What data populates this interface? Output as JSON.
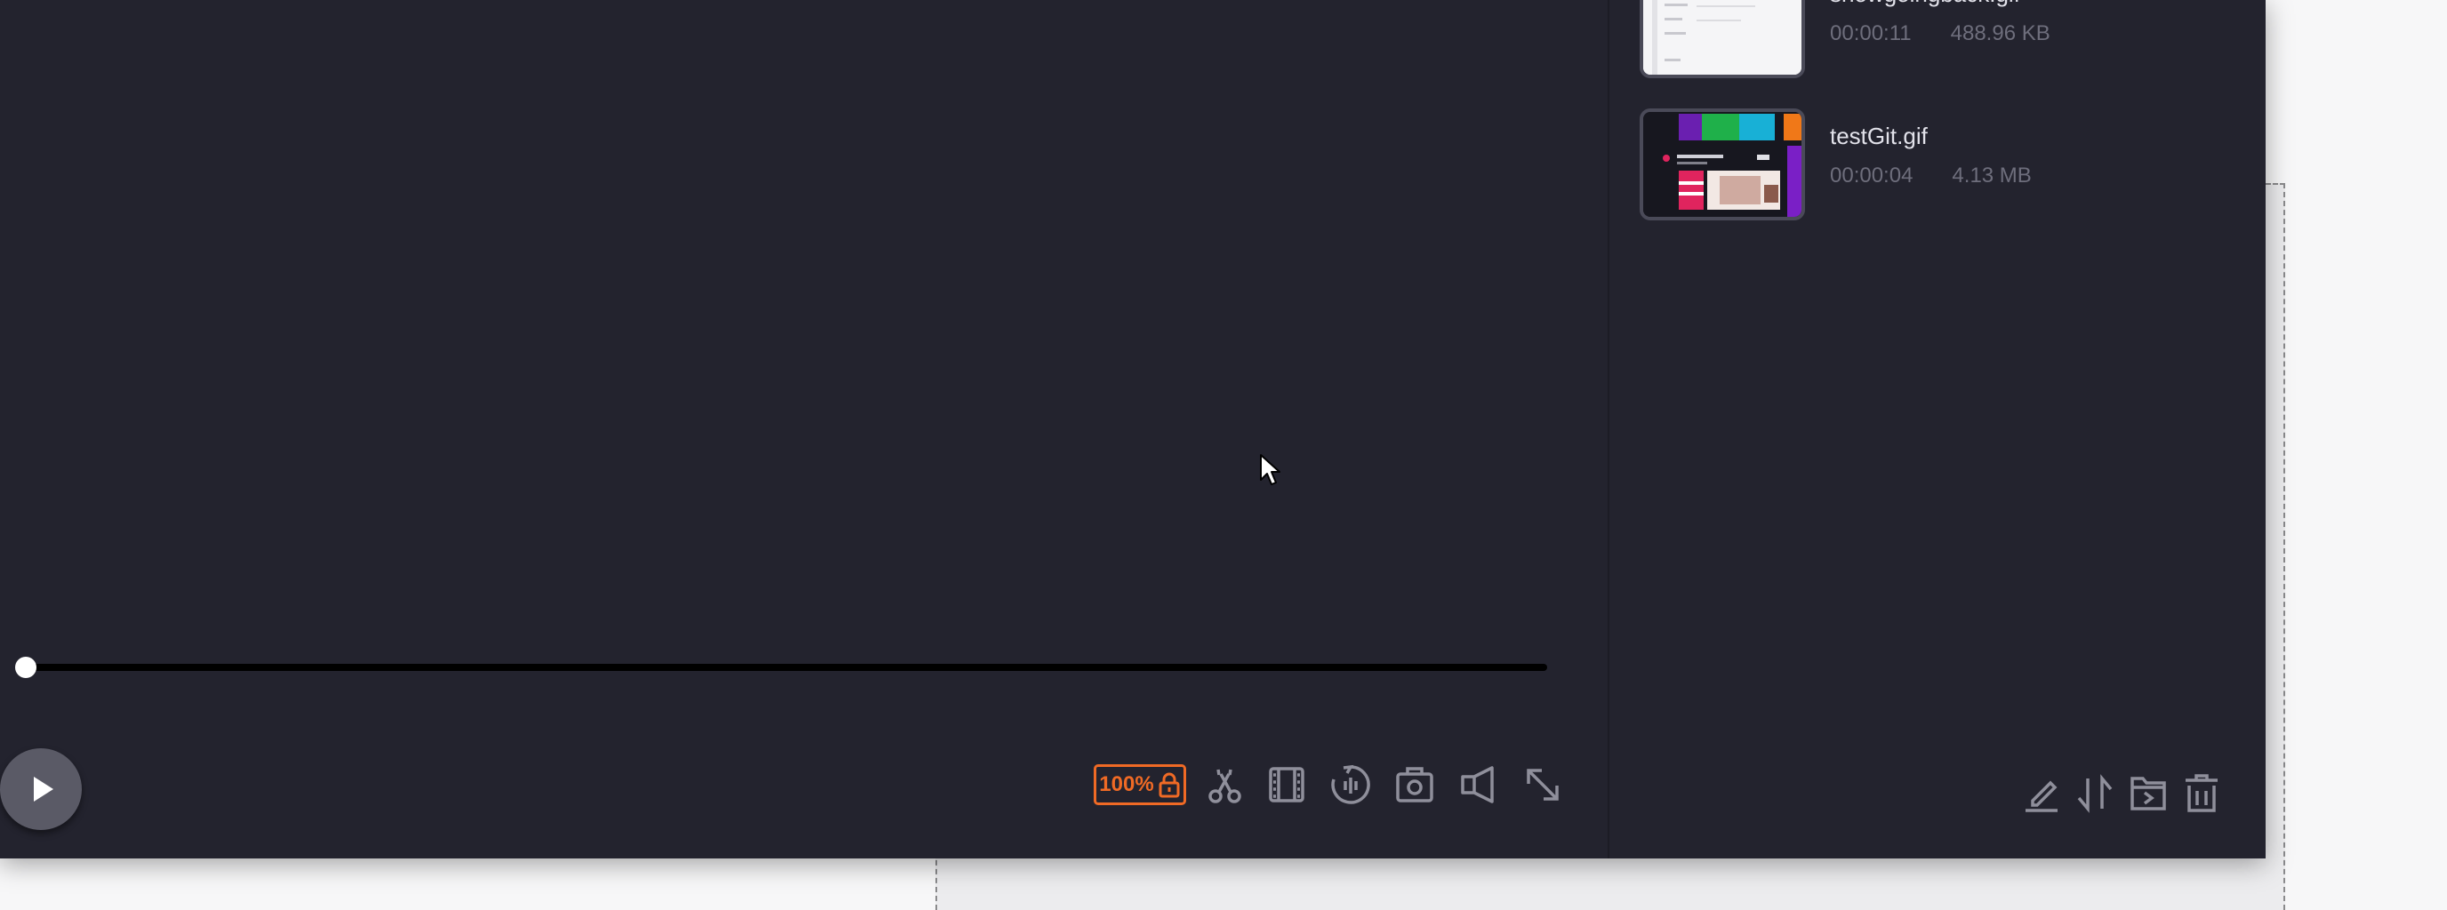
{
  "player": {
    "zoom_label": "100%",
    "toolbar_icons": [
      "scissors-icon",
      "frames-icon",
      "rotate-icon",
      "camera-icon",
      "volume-icon",
      "resize-icon"
    ]
  },
  "files": [
    {
      "name": "showgoingback.gif",
      "duration": "00:00:11",
      "size": "488.96 KB"
    },
    {
      "name": "testGit.gif",
      "duration": "00:00:04",
      "size": "4.13 MB"
    }
  ],
  "sidebar": {
    "footer_icons": [
      "edit-icon",
      "sort-icon",
      "open-folder-icon",
      "delete-icon"
    ]
  },
  "colors": {
    "window_bg": "#23232e",
    "accent": "#f06a25",
    "icon": "#8f8f9b",
    "text_primary": "#e2e2ea",
    "text_secondary": "#6e6e7c"
  }
}
